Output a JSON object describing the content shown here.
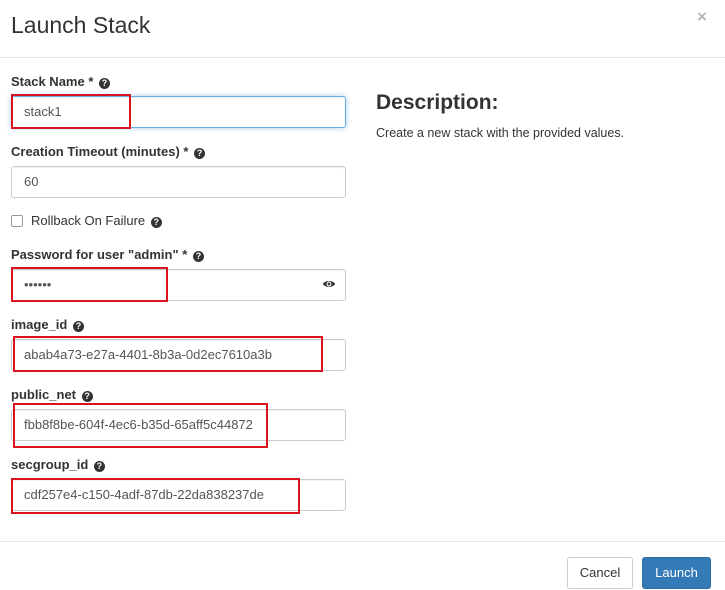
{
  "modal": {
    "title": "Launch Stack",
    "close_glyph": "×"
  },
  "form": {
    "stack_name": {
      "label": "Stack Name",
      "required": "*",
      "value": "stack1"
    },
    "timeout": {
      "label": "Creation Timeout (minutes)",
      "required": "*",
      "value": "60"
    },
    "rollback": {
      "label": "Rollback On Failure",
      "checked": false
    },
    "password": {
      "label": "Password for user \"admin\"",
      "required": "*",
      "value": "••••••"
    },
    "image_id": {
      "label": "image_id",
      "value": "abab4a73-e27a-4401-8b3a-0d2ec7610a3b"
    },
    "public_net": {
      "label": "public_net",
      "value": "fbb8f8be-604f-4ec6-b35d-65aff5c44872"
    },
    "secgroup_id": {
      "label": "secgroup_id",
      "value": "cdf257e4-c150-4adf-87db-22da838237de"
    }
  },
  "description": {
    "title": "Description:",
    "text": "Create a new stack with the provided values."
  },
  "footer": {
    "cancel_label": "Cancel",
    "launch_label": "Launch"
  },
  "icons": {
    "help": "question-circle-icon",
    "reveal_password": "eye-icon",
    "close": "close-icon"
  },
  "colors": {
    "primary": "#337ab7",
    "annotation": "#d9141e",
    "focus": "#66afe9"
  }
}
